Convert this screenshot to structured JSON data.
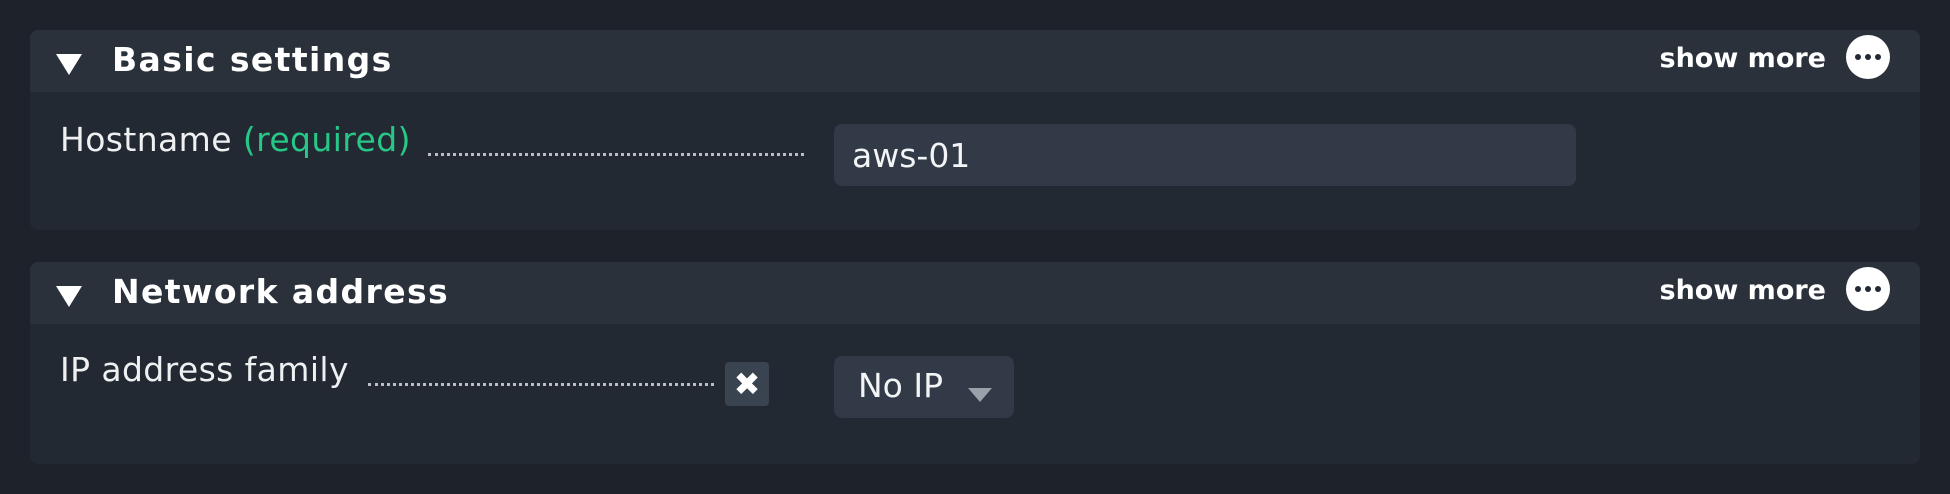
{
  "sections": {
    "basic": {
      "title": "Basic settings",
      "show_more": "show more",
      "hostname": {
        "label": "Hostname",
        "required": "(required)",
        "value": "aws-01"
      }
    },
    "network": {
      "title": "Network address",
      "show_more": "show more",
      "ip_family": {
        "label": "IP address family",
        "toggle_symbol": "✖",
        "value": "No IP"
      }
    }
  },
  "colors": {
    "background": "#1e222a",
    "panel": "#232932",
    "panel_header": "#2a313b",
    "input": "#313a46",
    "required": "#27c787"
  }
}
